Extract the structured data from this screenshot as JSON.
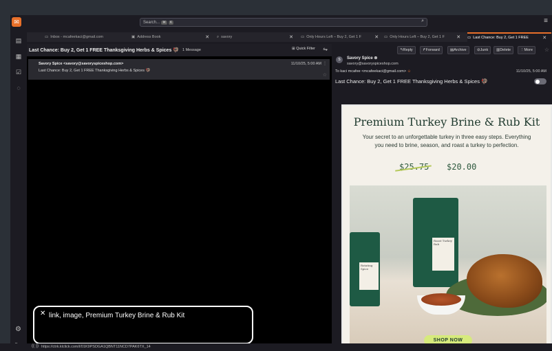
{
  "search": {
    "placeholder": "Search...",
    "shortcut_keys": [
      "⌘",
      "K"
    ]
  },
  "tabs": [
    {
      "label": "Inbox - mcafeekaci@gmail.com",
      "icon": "mail-icon"
    },
    {
      "label": "Address Book",
      "icon": "contacts-icon",
      "close": "✕"
    },
    {
      "label": "savory",
      "icon": "search-icon",
      "close": "✕"
    },
    {
      "label": "Only Hours Left – Buy 2, Get 1 F",
      "icon": "mail-icon",
      "close": "✕"
    },
    {
      "label": "Only Hours Left – Buy 2, Get 1 F",
      "icon": "mail-icon",
      "close": "✕"
    },
    {
      "label": "Last Chance: Buy 2, Get 1 FREE",
      "icon": "mail-icon",
      "close": "✕"
    }
  ],
  "list": {
    "title": "Last Chance: Buy 2, Get 1 FREE Thanksgiving Herbs & Spices 🦃",
    "count": "1 Message",
    "quick_filter": "Quick Filter",
    "message": {
      "from": "Savory Spice <savory@savoryspiceshop.com>",
      "date": "11/10/25, 5:00 AM",
      "subject": "Last Chance: Buy 2, Get 1 FREE Thanksgiving Herbs & Spices 🦃"
    }
  },
  "reader": {
    "actions": [
      "Reply",
      "Forward",
      "Archive",
      "Junk",
      "Delete",
      "More"
    ],
    "sender_initial": "S",
    "sender_name": "Savory Spice",
    "sender_email": "savory@savoryspiceshop.com",
    "to": "To  kaci mcafee <mcafeekaci@gmail.com>",
    "date": "11/10/25, 5:00 AM",
    "subject": "Last Chance: Buy 2, Get 1 FREE Thanksgiving Herbs & Spices 🦃"
  },
  "promo": {
    "title": "Premium Turkey Brine & Rub Kit",
    "description": "Your secret to an unforgettable turkey in three easy steps. Everything you need to brine, season, and roast a turkey to perfection.",
    "old_price": "$25.75",
    "new_price": "$20.00",
    "bag1_label": "Rotating Spice",
    "bag2_label": "Roast Turkey Rub",
    "cta": "SHOP NOW"
  },
  "tooltip": {
    "text": "link, image, Premium Turkey Brine & Rub Kit"
  },
  "status": {
    "url": "https://ctrk.klclick.com/l/01K9PSDGA1QBNT11NCD7PAK6TX_14"
  },
  "colors": {
    "accent": "#e8702a",
    "brand_green": "#1f3a2e",
    "cta": "#d6ea7c"
  }
}
